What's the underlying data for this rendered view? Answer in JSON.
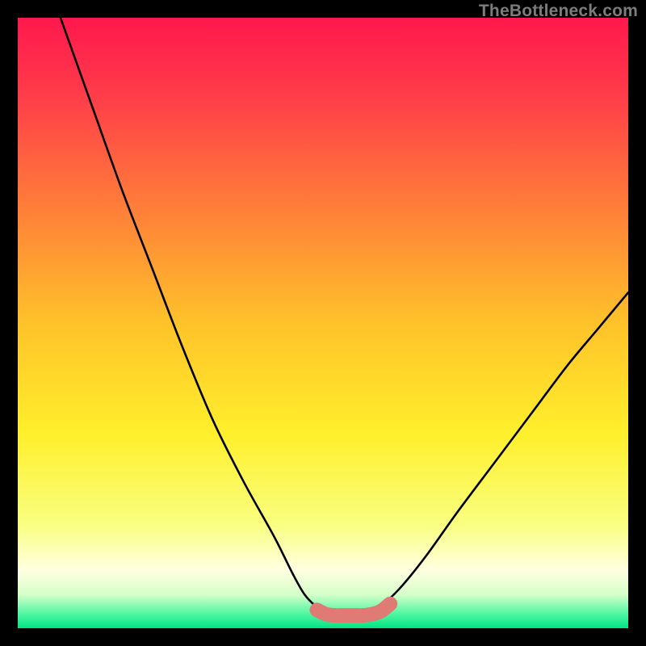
{
  "watermark": {
    "text": "TheBottleneck.com"
  },
  "chart_data": {
    "type": "line",
    "title": "",
    "xlabel": "",
    "ylabel": "",
    "xlim": [
      0,
      100
    ],
    "ylim": [
      0,
      100
    ],
    "grid": false,
    "legend": false,
    "series": [
      {
        "name": "left-curve",
        "x": [
          7,
          12,
          17,
          22,
          27,
          32,
          37,
          42,
          45,
          47,
          49,
          51
        ],
        "values": [
          100,
          86,
          72,
          59,
          46,
          34,
          24,
          15,
          9,
          5.5,
          3.5,
          2.5
        ]
      },
      {
        "name": "right-curve",
        "x": [
          58,
          60,
          63,
          67,
          72,
          78,
          84,
          90,
          95,
          100
        ],
        "values": [
          2.5,
          4,
          7,
          12,
          19,
          27,
          35,
          43,
          49,
          55
        ]
      },
      {
        "name": "bottom-link",
        "x": [
          49,
          50.5,
          52,
          53.5,
          55,
          56.5,
          58,
          59.5,
          61
        ],
        "values": [
          3,
          2.3,
          2.1,
          2.1,
          2.1,
          2.1,
          2.3,
          2.8,
          4
        ]
      }
    ],
    "colors": {
      "curve_stroke": "#000000",
      "link_stroke": "#e07a74",
      "gradient_stops": [
        {
          "offset": 0.0,
          "color": "#ff184d"
        },
        {
          "offset": 0.12,
          "color": "#ff3a4a"
        },
        {
          "offset": 0.3,
          "color": "#ff7a3a"
        },
        {
          "offset": 0.5,
          "color": "#ffc22a"
        },
        {
          "offset": 0.68,
          "color": "#ffef2b"
        },
        {
          "offset": 0.83,
          "color": "#f9ff80"
        },
        {
          "offset": 0.905,
          "color": "#ffffe0"
        },
        {
          "offset": 0.945,
          "color": "#d5ffc9"
        },
        {
          "offset": 0.975,
          "color": "#55f7a4"
        },
        {
          "offset": 1.0,
          "color": "#00e583"
        }
      ]
    }
  }
}
